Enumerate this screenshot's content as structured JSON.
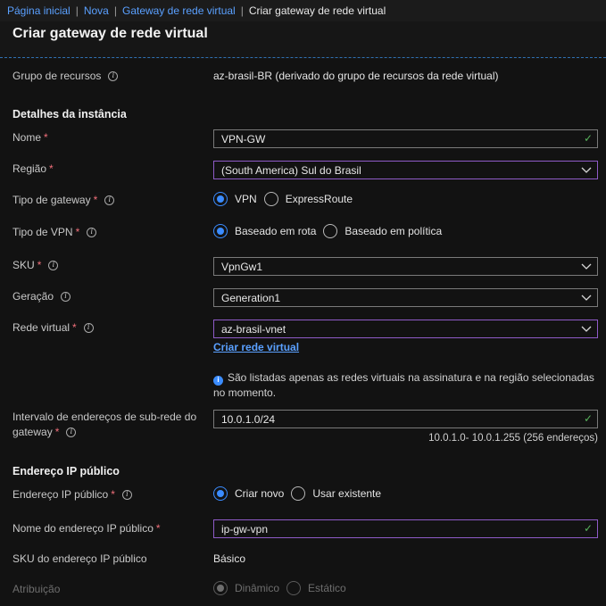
{
  "breadcrumb": {
    "items": [
      "Página inicial",
      "Nova",
      "Gateway de rede virtual"
    ],
    "current": "Criar gateway de rede virtual"
  },
  "page": {
    "title": "Criar gateway de rede virtual"
  },
  "resource_group": {
    "label": "Grupo de recursos",
    "value": "az-brasil-BR (derivado do grupo de recursos da rede virtual)"
  },
  "instance": {
    "heading": "Detalhes da instância",
    "name": {
      "label": "Nome",
      "required": "*",
      "value": "VPN-GW"
    },
    "region": {
      "label": "Região",
      "required": "*",
      "value": "(South America) Sul do Brasil"
    },
    "gateway_type": {
      "label": "Tipo de gateway",
      "required": "*",
      "options": [
        "VPN",
        "ExpressRoute"
      ],
      "selected": "VPN"
    },
    "vpn_type": {
      "label": "Tipo de VPN",
      "required": "*",
      "options": [
        "Baseado em rota",
        "Baseado em política"
      ],
      "selected": "Baseado em rota"
    },
    "sku": {
      "label": "SKU",
      "required": "*",
      "value": "VpnGw1"
    },
    "generation": {
      "label": "Geração",
      "value": "Generation1"
    },
    "vnet": {
      "label": "Rede virtual",
      "required": "*",
      "value": "az-brasil-vnet",
      "create_link": "Criar rede virtual",
      "note": "São listadas apenas as redes virtuais na assinatura e na região selecionadas no momento."
    },
    "subnet": {
      "label_line1": "Intervalo de endereços de sub-rede do",
      "label_line2": "gateway",
      "required": "*",
      "value": "10.0.1.0/24",
      "hint": "10.0.1.0- 10.0.1.255 (256 endereços)"
    }
  },
  "public_ip": {
    "heading": "Endereço IP público",
    "address": {
      "label": "Endereço IP público",
      "required": "*",
      "options": [
        "Criar novo",
        "Usar existente"
      ],
      "selected": "Criar novo"
    },
    "name": {
      "label": "Nome do endereço IP público",
      "required": "*",
      "value": "ip-gw-vpn"
    },
    "sku": {
      "label": "SKU do endereço IP público",
      "value": "Básico"
    },
    "assignment": {
      "label": "Atribuição",
      "options": [
        "Dinâmico",
        "Estático"
      ],
      "selected": "Dinâmico"
    }
  },
  "icons": {
    "info": "info-icon",
    "check": "checkmark-icon",
    "dropdown": "chevron-down-icon"
  },
  "colors": {
    "accent": "#3b8cff",
    "link": "#5aa0ff",
    "required": "#f1707b",
    "valid": "#58b35c",
    "focus_border": "#8f5bc8"
  }
}
